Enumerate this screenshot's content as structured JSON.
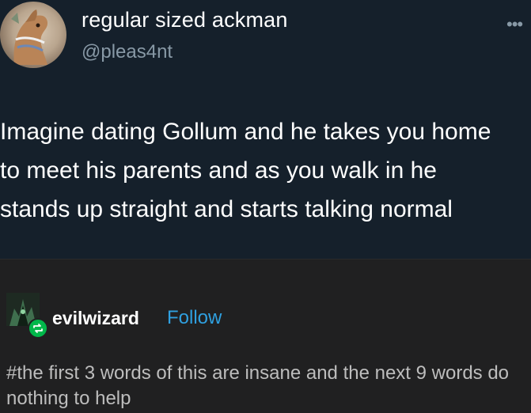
{
  "tweet": {
    "display_name": "regular sized ackman",
    "handle": "@pleas4nt",
    "more_glyph": "•••",
    "text": "Imagine dating Gollum and he takes you home\nto meet his parents and as you walk in he\nstands up straight and starts talking normal",
    "avatar_icon": "horse-avatar-icon"
  },
  "tumblr_post": {
    "username": "evilwizard",
    "follow_label": "Follow",
    "tags": "#the first 3 words of this are insane and the next 9 words do nothing to help",
    "avatar_icon": "wizard-avatar-icon",
    "badge_icon": "reblog-icon",
    "colors": {
      "follow": "#2fa0e0",
      "reblog_badge": "#00b74a"
    }
  }
}
